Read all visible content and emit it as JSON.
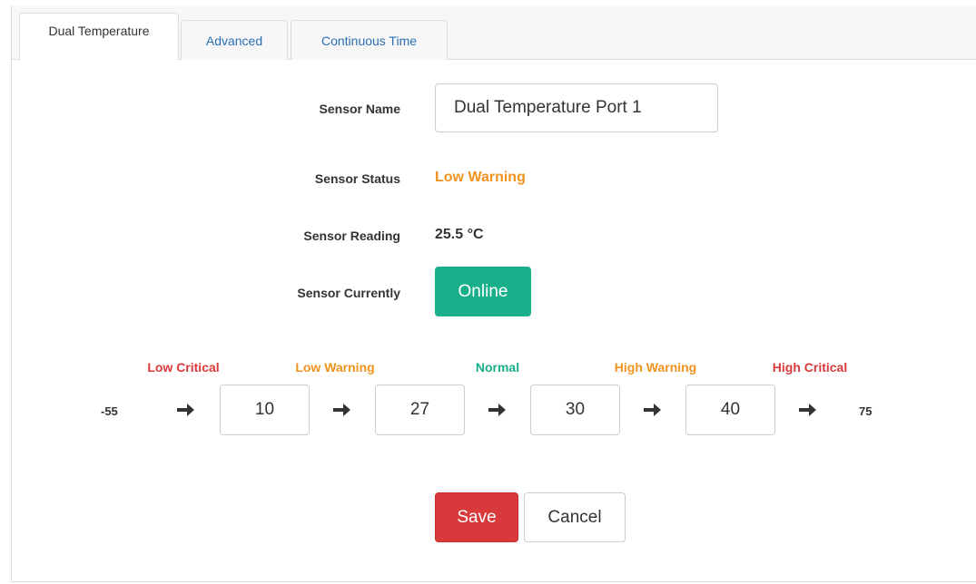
{
  "tabs": [
    {
      "label": "Dual Temperature",
      "active": true
    },
    {
      "label": "Advanced",
      "active": false
    },
    {
      "label": "Continuous Time",
      "active": false
    }
  ],
  "form": {
    "sensor_name_label": "Sensor Name",
    "sensor_name_value": "Dual Temperature Port 1",
    "sensor_status_label": "Sensor Status",
    "sensor_status_value": "Low Warning",
    "sensor_reading_label": "Sensor Reading",
    "sensor_reading_value": "25.5 °C",
    "sensor_currently_label": "Sensor Currently",
    "sensor_currently_value": "Online"
  },
  "thresholds": {
    "zones": [
      {
        "label": "Low Critical",
        "color": "#d9393a"
      },
      {
        "label": "Low Warning",
        "color": "#f0931e"
      },
      {
        "label": "Normal",
        "color": "#1aaf8b"
      },
      {
        "label": "High Warning",
        "color": "#f0931e"
      },
      {
        "label": "High Critical",
        "color": "#d9393a"
      }
    ],
    "min": "-55",
    "max": "75",
    "values": [
      "10",
      "27",
      "30",
      "40"
    ],
    "arrow_icon": "arrow-right-icon"
  },
  "actions": {
    "save_label": "Save",
    "cancel_label": "Cancel"
  },
  "colors": {
    "status_warning": "#f0931e",
    "online": "#1aaf8b",
    "save": "#d9393a",
    "link": "#2a6db5"
  }
}
